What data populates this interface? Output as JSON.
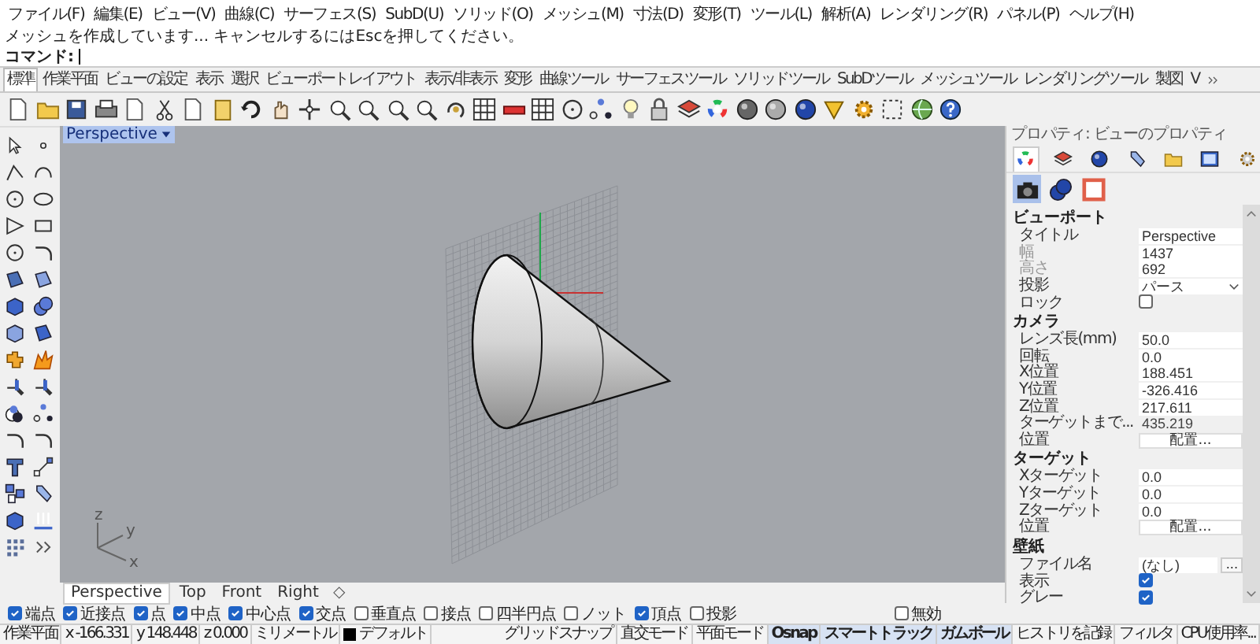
{
  "menu_bar": [
    "ファイル(F)",
    "編集(E)",
    "ビュー(V)",
    "曲線(C)",
    "サーフェス(S)",
    "SubD(U)",
    "ソリッド(O)",
    "メッシュ(M)",
    "寸法(D)",
    "変形(T)",
    "ツール(L)",
    "解析(A)",
    "レンダリング(R)",
    "パネル(P)",
    "ヘルプ(H)"
  ],
  "command_history": [
    "メッシュを作成しています... キャンセルするにはEscを押してください。"
  ],
  "command_prompt": "コマンド:",
  "toolbar_tabs": [
    {
      "label": "標準",
      "selected": true
    },
    {
      "label": "作業平面",
      "selected": false
    },
    {
      "label": "ビューの設定",
      "selected": false
    },
    {
      "label": "表示",
      "selected": false
    },
    {
      "label": "選択",
      "selected": false
    },
    {
      "label": "ビューポートレイアウト",
      "selected": false
    },
    {
      "label": "表示/非表示",
      "selected": false
    },
    {
      "label": "変形",
      "selected": false
    },
    {
      "label": "曲線ツール",
      "selected": false
    },
    {
      "label": "サーフェスツール",
      "selected": false
    },
    {
      "label": "ソリッドツール",
      "selected": false
    },
    {
      "label": "SubDツール",
      "selected": false
    },
    {
      "label": "メッシュツール",
      "selected": false
    },
    {
      "label": "レンダリングツール",
      "selected": false
    },
    {
      "label": "製図",
      "selected": false
    },
    {
      "label": "V",
      "selected": false
    }
  ],
  "viewport": {
    "title": "Perspective",
    "axis_labels": [
      "z",
      "y",
      "x"
    ]
  },
  "viewport_tabs": [
    {
      "label": "Perspective",
      "selected": true
    },
    {
      "label": "Top",
      "selected": false
    },
    {
      "label": "Front",
      "selected": false
    },
    {
      "label": "Right",
      "selected": false
    }
  ],
  "new_tab_symbol": "◇",
  "properties": {
    "title": "プロパティ: ビューのプロパティ",
    "tabs": [
      {
        "selected": true
      },
      {
        "selected": false
      },
      {
        "selected": false
      },
      {
        "selected": false
      },
      {
        "selected": false
      },
      {
        "selected": false
      },
      {
        "selected": false
      }
    ],
    "subtabs": [
      {
        "selected": true
      },
      {
        "selected": false
      },
      {
        "selected": false
      }
    ],
    "sections": [
      {
        "heading": "ビューポート",
        "rows": [
          {
            "kind": "field",
            "label": "タイトル",
            "value": "Perspective",
            "disabled": false
          },
          {
            "kind": "field",
            "label": "幅",
            "value": "1437",
            "disabled": true
          },
          {
            "kind": "field",
            "label": "高さ",
            "value": "692",
            "disabled": true
          },
          {
            "kind": "dropdown",
            "label": "投影",
            "value": "パース",
            "disabled": false
          },
          {
            "kind": "checkbox",
            "label": "ロック",
            "checked": false,
            "disabled": false
          }
        ]
      },
      {
        "heading": "カメラ",
        "rows": [
          {
            "kind": "field",
            "label": "レンズ長(mm)",
            "value": "50.0",
            "disabled": false
          },
          {
            "kind": "field",
            "label": "回転",
            "value": "0.0",
            "disabled": false
          },
          {
            "kind": "field",
            "label": "X位置",
            "value": "188.451",
            "disabled": false
          },
          {
            "kind": "field",
            "label": "Y位置",
            "value": "-326.416",
            "disabled": false
          },
          {
            "kind": "field",
            "label": "Z位置",
            "value": "217.611",
            "disabled": false
          },
          {
            "kind": "readonly",
            "label": "ターゲットまで...",
            "value": "435.219",
            "disabled": false
          },
          {
            "kind": "button",
            "label": "位置",
            "value": "配置...",
            "disabled": false
          }
        ]
      },
      {
        "heading": "ターゲット",
        "rows": [
          {
            "kind": "field",
            "label": "Xターゲット",
            "value": "0.0",
            "disabled": false
          },
          {
            "kind": "field",
            "label": "Yターゲット",
            "value": "0.0",
            "disabled": false
          },
          {
            "kind": "field",
            "label": "Zターゲット",
            "value": "0.0",
            "disabled": false
          },
          {
            "kind": "button",
            "label": "位置",
            "value": "配置...",
            "disabled": false
          }
        ]
      },
      {
        "heading": "壁紙",
        "rows": [
          {
            "kind": "file",
            "label": "ファイル名",
            "value": "(なし)",
            "button": "...",
            "disabled": false
          },
          {
            "kind": "checkbox",
            "label": "表示",
            "checked": true,
            "disabled": false
          },
          {
            "kind": "checkbox",
            "label": "グレー",
            "checked": true,
            "disabled": false
          }
        ]
      }
    ]
  },
  "osnaps": [
    {
      "label": "端点",
      "checked": true
    },
    {
      "label": "近接点",
      "checked": true
    },
    {
      "label": "点",
      "checked": true
    },
    {
      "label": "中点",
      "checked": true
    },
    {
      "label": "中心点",
      "checked": true
    },
    {
      "label": "交点",
      "checked": true
    },
    {
      "label": "垂直点",
      "checked": false
    },
    {
      "label": "接点",
      "checked": false
    },
    {
      "label": "四半円点",
      "checked": false
    },
    {
      "label": "ノット",
      "checked": false
    },
    {
      "label": "頂点",
      "checked": true
    },
    {
      "label": "投影",
      "checked": false
    }
  ],
  "osnap_disable": {
    "label": "無効",
    "checked": false
  },
  "status_bar": [
    {
      "kind": "text",
      "text": "作業平面",
      "active": false
    },
    {
      "kind": "text",
      "text": "x -166.331",
      "active": false
    },
    {
      "kind": "text",
      "text": "y 148.448",
      "active": false
    },
    {
      "kind": "text",
      "text": "z 0.000",
      "active": false
    },
    {
      "kind": "text",
      "text": "ミリメートル",
      "active": false
    },
    {
      "kind": "layer",
      "text": "デフォルト",
      "color": "#000000",
      "active": false
    },
    {
      "kind": "toggle",
      "text": "グリッドスナップ",
      "active": false
    },
    {
      "kind": "toggle",
      "text": "直交モード",
      "active": false
    },
    {
      "kind": "toggle",
      "text": "平面モード",
      "active": false
    },
    {
      "kind": "toggle",
      "text": "Osnap",
      "active": true
    },
    {
      "kind": "toggle",
      "text": "スマートトラック",
      "active": true
    },
    {
      "kind": "toggle",
      "text": "ガムボール",
      "active": true
    },
    {
      "kind": "toggle",
      "text": "ヒストリを記録",
      "active": false
    },
    {
      "kind": "toggle",
      "text": "フィルタ",
      "active": false
    },
    {
      "kind": "text",
      "text": "CPU使用率...",
      "active": false
    }
  ]
}
